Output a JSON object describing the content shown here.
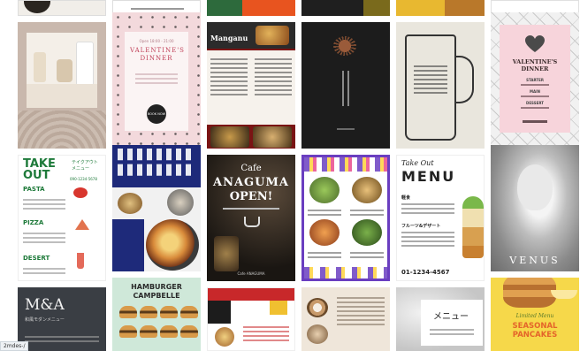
{
  "cards": {
    "valentine_pink": {
      "small": "Open 18:00 - 21:00",
      "title": "VALENTINE'S DINNER",
      "button": "BOOK NOW"
    },
    "manganu": {
      "title": "Manganu"
    },
    "valentine_heart": {
      "title": "VALENTINE'S DINNER",
      "sections": [
        "STARTER",
        "MAIN",
        "DESSERT"
      ]
    },
    "takeout_green": {
      "title_line1": "TAKE",
      "title_line2": "OUT",
      "sub_jp": "テイクアウト メニュー",
      "phone": "090-1234-5678",
      "sections": [
        "PASTA",
        "PIZZA",
        "DESERT"
      ]
    },
    "cafe_anaguma": {
      "line1": "Cafe",
      "line2": "ANAGUMA",
      "line3": "OPEN!",
      "footer": "Cafe ANAGUMA"
    },
    "takeout_menu": {
      "line1": "Take Out",
      "line2": "MENU",
      "sections": [
        "軽食",
        "フルーツ&デザート"
      ],
      "phone": "01-1234-4567"
    },
    "venus": {
      "title": "VENUS"
    },
    "ma": {
      "title": "M&A",
      "sub": "和風モダンメニュー"
    },
    "hamburger": {
      "title_line1": "HAMBURGER",
      "title_line2": "CAMPBELLE"
    },
    "menu_jp": {
      "title": "メニュー"
    },
    "pancakes": {
      "small": "Limited Menu",
      "title": "SEASONAL PANCAKES"
    }
  },
  "status_text": "2mdes-/",
  "colors": {
    "pink": "#f3d9dc",
    "dark": "#1c1c1c",
    "navy": "#1e2a7a",
    "green": "#4a7a52",
    "purple": "#6a3ec0",
    "red": "#c8282a",
    "mint": "#cfe8d9"
  }
}
